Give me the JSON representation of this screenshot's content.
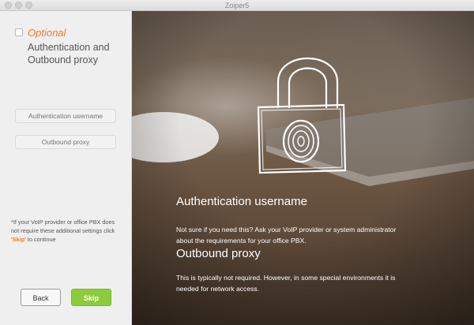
{
  "window": {
    "title": "Zoiper5"
  },
  "left_panel": {
    "optional_label": "Optional",
    "heading": "Authentication and Outbound proxy",
    "auth_username_placeholder": "Authentication username",
    "outbound_proxy_placeholder": "Outbound proxy",
    "note_before": "*If your VoIP provider or office PBX does not require these additional settings click ",
    "note_skip": "'Skip'",
    "note_after": " to continue",
    "back_label": "Back",
    "skip_label": "Skip"
  },
  "right_panel": {
    "auth_heading": "Authentication username",
    "auth_text": "Not sure if you need this? Ask your VoIP provider or system administrator about the requirements for your office PBX.",
    "proxy_heading": "Outbound proxy",
    "proxy_text": "This is typically not required. However, in some special environments it is needed for network access."
  },
  "colors": {
    "accent_orange": "#f07a23",
    "skip_green": "#8ccc3c"
  },
  "icons": [
    "padlock-fingerprint-icon"
  ]
}
